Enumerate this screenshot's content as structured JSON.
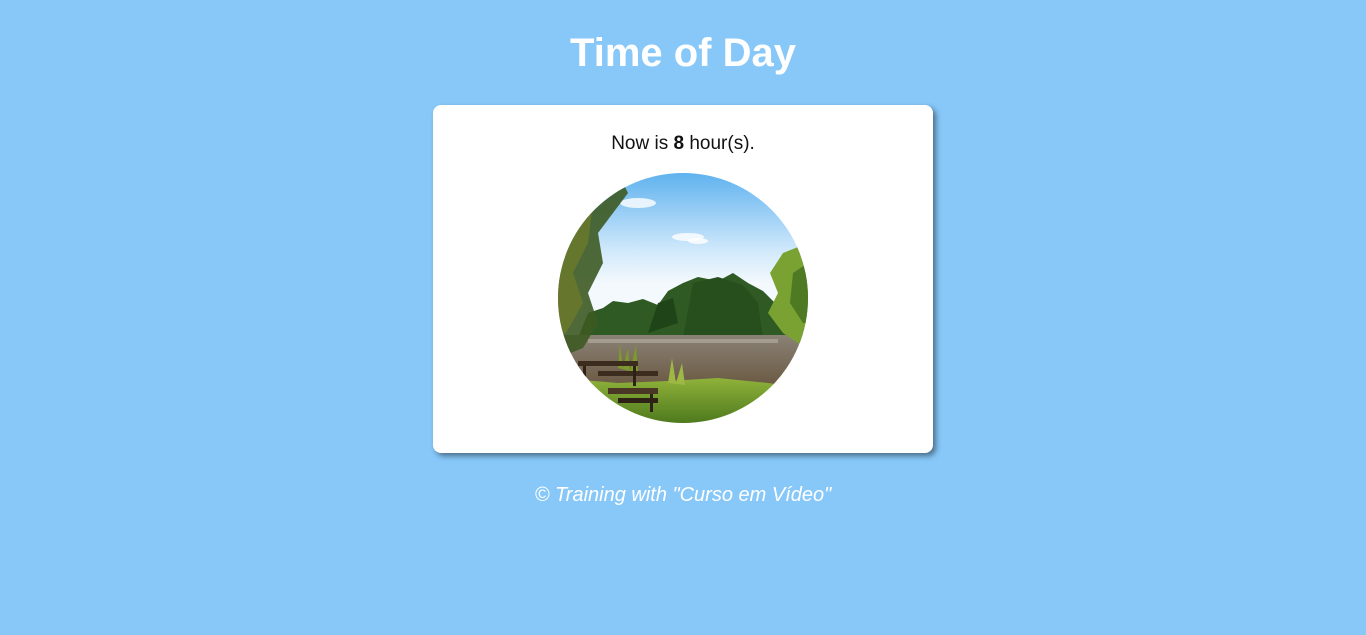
{
  "page": {
    "title": "Time of Day"
  },
  "card": {
    "prefix": "Now is ",
    "hour": "8",
    "suffix": " hour(s).",
    "image_alt": "morning"
  },
  "footer": {
    "text": "© Training with \"Curso em Vídeo\""
  },
  "colors": {
    "background": "#87c8f9",
    "card": "#ffffff",
    "title": "#ffffff"
  }
}
